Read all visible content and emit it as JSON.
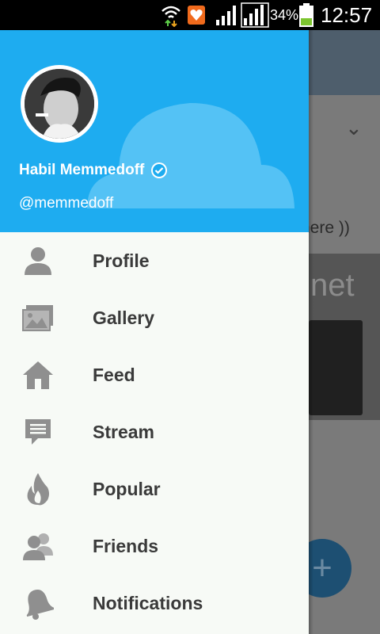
{
  "status_bar": {
    "battery_percent": "34%",
    "time": "12:57",
    "icons": [
      "wifi-icon",
      "notification-app-icon",
      "signal-icon",
      "signal-icon-2",
      "battery-icon"
    ]
  },
  "background": {
    "snippet_text": "here ))",
    "image_text": "net"
  },
  "drawer": {
    "user": {
      "name": "Habil Memmedoff",
      "handle": "@memmedoff",
      "verified": true
    },
    "accent": "#1eacf0",
    "items": [
      {
        "label": "Profile",
        "icon": "person-icon"
      },
      {
        "label": "Gallery",
        "icon": "gallery-icon"
      },
      {
        "label": "Feed",
        "icon": "home-icon"
      },
      {
        "label": "Stream",
        "icon": "chat-icon"
      },
      {
        "label": "Popular",
        "icon": "fire-icon"
      },
      {
        "label": "Friends",
        "icon": "friends-icon"
      },
      {
        "label": "Notifications",
        "icon": "bell-icon"
      }
    ]
  }
}
